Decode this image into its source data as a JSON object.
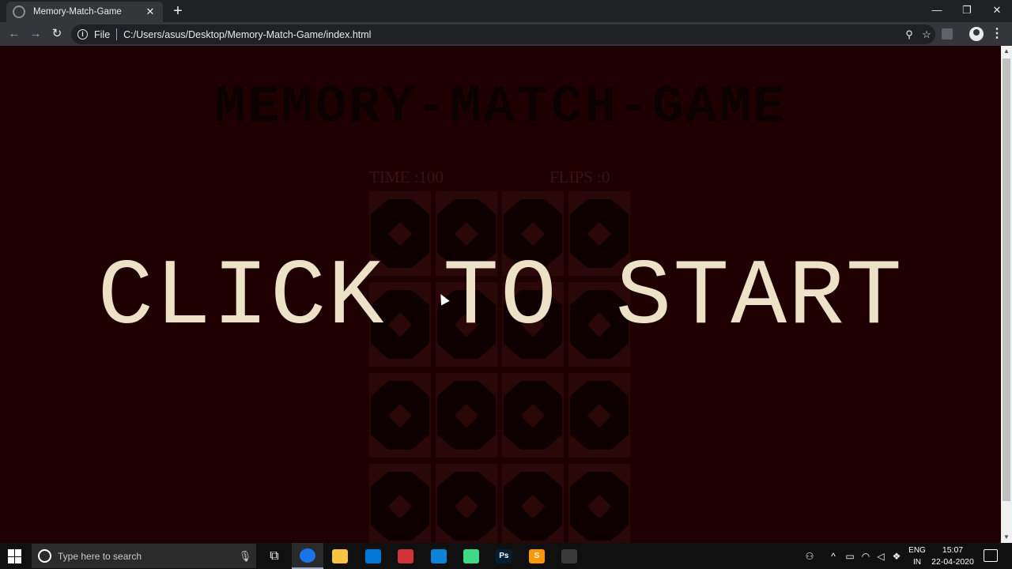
{
  "browser": {
    "tab_title": "Memory-Match-Game",
    "tab_close": "✕",
    "new_tab": "+",
    "window_controls": {
      "minimize": "—",
      "maximize": "❐",
      "close": "✕"
    },
    "nav": {
      "back": "←",
      "forward": "→",
      "reload": "↻"
    },
    "omnibox": {
      "info": "i",
      "scheme_label": "File",
      "url": "C:/Users/asus/Desktop/Memory-Match-Game/index.html",
      "zoom_icon": "⚲",
      "bookmark_icon": "☆"
    },
    "menu": "⋮"
  },
  "game": {
    "title": "MEMORY-MATCH-GAME",
    "time_label": "TIME :100",
    "flips_label": "FLIPS :0",
    "overlay_text": "CLICK TO START",
    "card_rows": 4,
    "card_cols": 4
  },
  "taskbar": {
    "search_placeholder": "Type here to search",
    "mic_icon": "🎙",
    "task_view_icon": "⧉",
    "apps": [
      {
        "name": "chrome",
        "color": "#1a73e8",
        "label": ""
      },
      {
        "name": "file-explorer",
        "color": "#f6c344",
        "label": ""
      },
      {
        "name": "store",
        "color": "#0078d7",
        "label": ""
      },
      {
        "name": "gift",
        "color": "#d13438",
        "label": ""
      },
      {
        "name": "mail",
        "color": "#0a84d6",
        "label": ""
      },
      {
        "name": "android",
        "color": "#3ddc84",
        "label": ""
      },
      {
        "name": "photoshop",
        "color": "#001e36",
        "label": "Ps"
      },
      {
        "name": "sublime",
        "color": "#ff9800",
        "label": "S"
      },
      {
        "name": "obs",
        "color": "#3a3a3a",
        "label": ""
      }
    ],
    "tray": {
      "people_icon": "⚇",
      "chevron_icon": "^",
      "battery_icon": "▭",
      "wifi_icon": "◠",
      "volume_icon": "◁",
      "dropbox_icon": "❖"
    },
    "lang_line1": "ENG",
    "lang_line2": "IN",
    "time": "15:07",
    "date": "22-04-2020"
  }
}
